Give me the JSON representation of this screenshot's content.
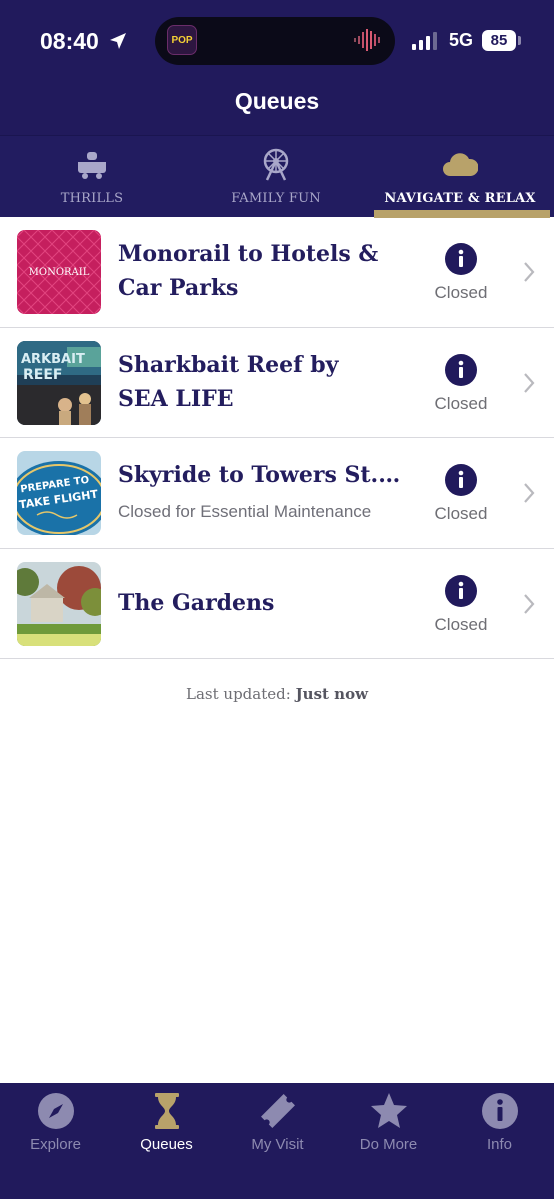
{
  "status_bar": {
    "time": "08:40",
    "network": "5G",
    "battery": "85",
    "island_app": "POP"
  },
  "header": {
    "title": "Queues"
  },
  "tabs": [
    {
      "label": "THRILLS",
      "icon": "ride-car-icon",
      "active": false
    },
    {
      "label": "FAMILY FUN",
      "icon": "ferris-wheel-icon",
      "active": false
    },
    {
      "label": "NAVIGATE & RELAX",
      "icon": "cloud-icon",
      "active": true
    }
  ],
  "rides": [
    {
      "title": "Monorail to Hotels & Car Parks",
      "title_line1": "Monorail to Hotels &",
      "title_line2": "Car Parks",
      "subtitle": "",
      "status": "Closed",
      "thumb_text": "MONORAIL"
    },
    {
      "title": "Sharkbait Reef by SEA LIFE",
      "title_line1": "Sharkbait Reef by",
      "title_line2": "SEA LIFE",
      "subtitle": "",
      "status": "Closed"
    },
    {
      "title": "Skyride to Towers St. (F...",
      "subtitle": "Closed for Essential Maintenance",
      "status": "Closed",
      "thumb_text": "PREPARE TO TAKE FLIGHT"
    },
    {
      "title": "The Gardens",
      "subtitle": "",
      "status": "Closed"
    }
  ],
  "footer": {
    "updated_label": "Last updated:",
    "updated_value": "Just now"
  },
  "bottom_nav": [
    {
      "label": "Explore",
      "icon": "compass-icon",
      "active": false
    },
    {
      "label": "Queues",
      "icon": "hourglass-icon",
      "active": true
    },
    {
      "label": "My Visit",
      "icon": "ticket-icon",
      "active": false
    },
    {
      "label": "Do More",
      "icon": "star-icon",
      "active": false
    },
    {
      "label": "Info",
      "icon": "info-icon",
      "active": false
    }
  ],
  "colors": {
    "primary": "#211a5c",
    "accent": "#b8a26a",
    "text_dark": "#231d5e",
    "muted": "#6e6e74"
  }
}
